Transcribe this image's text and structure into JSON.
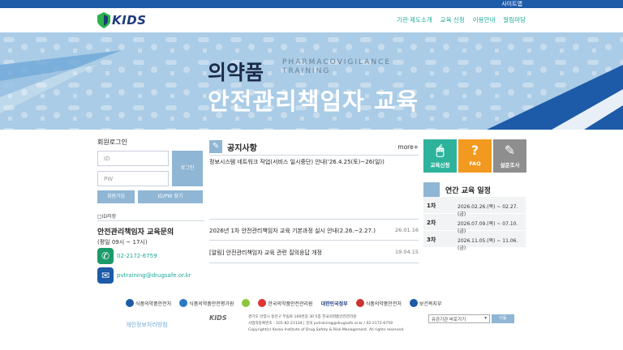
{
  "topbar": {
    "sitemap": "사이트맵"
  },
  "header": {
    "logo_text": "KIDS",
    "nav": [
      "기관·제도소개",
      "교육 신청",
      "이용안내",
      "알림마당"
    ]
  },
  "hero": {
    "title_line1": "의약품",
    "eng_line1": "PHARMACOVIGILANCE",
    "eng_line2": "TRAINING",
    "title_line2": "안전관리책임자 교육"
  },
  "login": {
    "title": "회원로그인",
    "id_placeholder": "ID",
    "pw_placeholder": "PW",
    "login_button": "로그인",
    "join_button": "회원가입",
    "find_button": "ID/PW 찾기",
    "id_save": "□ID저장"
  },
  "inquiry": {
    "title": "안전관리책임자 교육문의",
    "hours": "(평일 09시 ~ 17시)",
    "phone": "02-2172-6759",
    "email": "pvtraining@drugsafe.or.kr"
  },
  "notice": {
    "title": "공지사항",
    "more": "more+",
    "items": [
      {
        "text": "정보시스템 네트워크 작업(서비스 일시중단) 안내('26.4.25(토)~26(일))",
        "date": ""
      },
      {
        "text": "2026년 1차 안전관리책임자 교육 기본과정 실시 안내(2.26.~2.27.)",
        "date": "26.01.16"
      },
      {
        "text": "[알림] 안전관리책임자 교육 관련 질의응답 개정",
        "date": "19.04.15"
      }
    ]
  },
  "quick_links": [
    {
      "label": "교육신청",
      "icon": "mouse-icon",
      "color": "#2db39c"
    },
    {
      "label": "FAQ",
      "icon": "question-icon",
      "color": "#f29a1f"
    },
    {
      "label": "설문조사",
      "icon": "pen-icon",
      "color": "#8e8e8e"
    }
  ],
  "schedule": {
    "title": "연간 교육 일정",
    "rows": [
      {
        "no": "1차",
        "dates": "2026.02.26.(목) ~ 02.27.(금)"
      },
      {
        "no": "2차",
        "dates": "2026.07.09.(목) ~ 07.10.(금)"
      },
      {
        "no": "3차",
        "dates": "2026.11.05.(목) ~ 11.06.(금)"
      }
    ]
  },
  "footer": {
    "logos": [
      "식품의약품안전처",
      "식품의약품안전평가원",
      "",
      "한국의약품안전관리원",
      "대한민국정부",
      "식품의약품안전처",
      "보건복지부"
    ],
    "privacy": "개인정보처리방침",
    "kids": "KIDS",
    "address": "경기도 안양시 동안구 부림로 169번길 30 5층 한국의약품안전관리원",
    "bizno": "사업자등록번호 : 101-82-21134 | 문의 pvtraining@drugsafe.or.kr / 02-2172-6759",
    "copyright": "Copyright(c) Korea Institute of Drug Safety & Risk Management. All rights reserved.",
    "select_label": "유관기관 바로가기",
    "move_button": "이동"
  }
}
